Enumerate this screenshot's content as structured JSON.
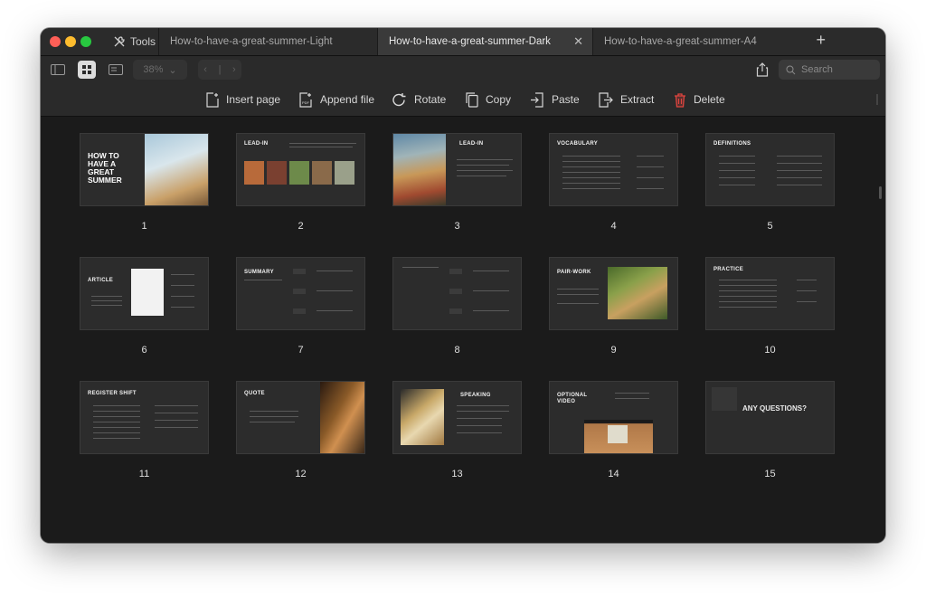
{
  "tools_label": "Tools",
  "tabs": [
    {
      "label": "How-to-have-a-great-summer-Light",
      "active": false
    },
    {
      "label": "How-to-have-a-great-summer-Dark",
      "active": true
    },
    {
      "label": "How-to-have-a-great-summer-A4",
      "active": false
    }
  ],
  "toolbar": {
    "zoom": "38%",
    "search_placeholder": "Search"
  },
  "actions": {
    "insert_page": "Insert page",
    "append_file": "Append file",
    "rotate": "Rotate",
    "copy": "Copy",
    "paste": "Paste",
    "extract": "Extract",
    "delete": "Delete"
  },
  "pages": [
    {
      "number": "1",
      "title": "HOW TO HAVE A GREAT SUMMER"
    },
    {
      "number": "2",
      "title": "LEAD-IN"
    },
    {
      "number": "3",
      "title": "LEAD-IN"
    },
    {
      "number": "4",
      "title": "VOCABULARY"
    },
    {
      "number": "5",
      "title": "DEFINITIONS"
    },
    {
      "number": "6",
      "title": "ARTICLE"
    },
    {
      "number": "7",
      "title": "SUMMARY"
    },
    {
      "number": "8",
      "title": ""
    },
    {
      "number": "9",
      "title": "PAIR-WORK"
    },
    {
      "number": "10",
      "title": "PRACTICE"
    },
    {
      "number": "11",
      "title": "REGISTER SHIFT"
    },
    {
      "number": "12",
      "title": "QUOTE"
    },
    {
      "number": "13",
      "title": "SPEAKING"
    },
    {
      "number": "14",
      "title": "OPTIONAL VIDEO"
    },
    {
      "number": "15",
      "title": "ANY QUESTIONS?"
    }
  ],
  "colors": {
    "delete_icon": "#e0453f",
    "active_tab": "#3a3a3a"
  }
}
